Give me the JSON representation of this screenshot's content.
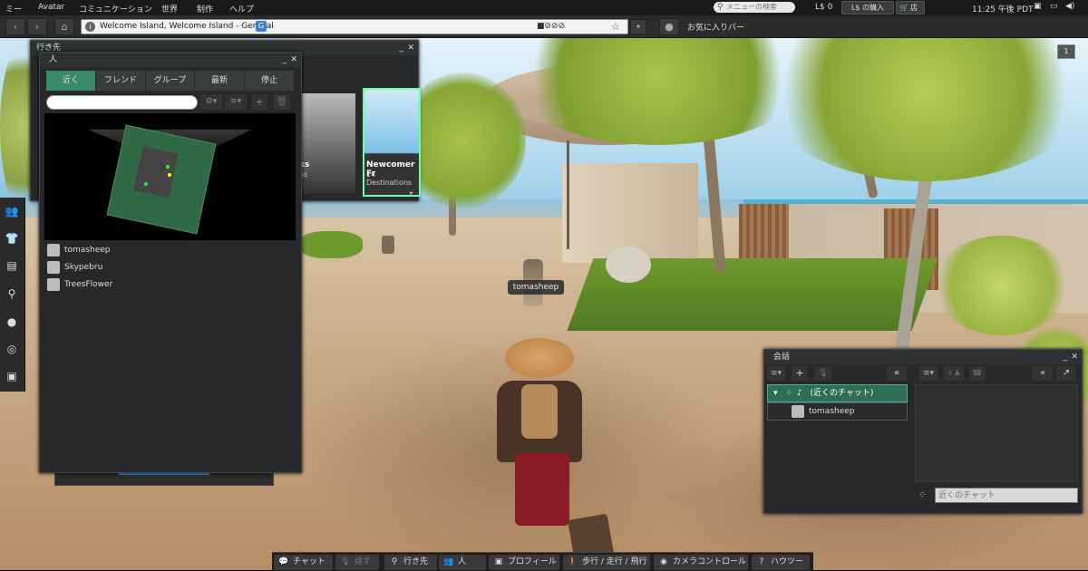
{
  "menu": {
    "items": [
      "ミー",
      "Avatar",
      "コミュニケーション",
      "世界",
      "制作",
      "ヘルプ"
    ],
    "search_placeholder": "メニューの検索",
    "balance": "L$ 0",
    "buy_label": "L$ の購入",
    "shop_label": "店",
    "time": "11:25 午後 PDT"
  },
  "nav": {
    "url": "Welcome Island, Welcome Island - General",
    "maturity_badge": "G",
    "favorites_label": "お気に入りバー"
  },
  "destinations_panel": {
    "title": "行き先",
    "card1_title": "ks",
    "card1_sub": "ns",
    "card2_title": "Newcomer Fr",
    "card2_sub": "14 Destinations"
  },
  "people_panel": {
    "title": "人",
    "tabs": [
      "近く",
      "フレンド",
      "グループ",
      "最新",
      "停止"
    ],
    "search_value": "",
    "people": [
      "tomasheep",
      "Skypebru",
      "TreesFlower"
    ]
  },
  "nametag": "tomasheep",
  "conversations": {
    "title": "会話",
    "group": "(近くのチャット)",
    "member": "tomasheep",
    "chat_placeholder": "近くのチャット"
  },
  "bottom": {
    "chat": "チャット",
    "speak": "話す",
    "destinations": "行き先",
    "people": "人",
    "profile": "プロフィール",
    "move": "歩行 / 走行 / 飛行",
    "camera": "カメラコントロール",
    "howto": "ハウツー"
  },
  "colors": {
    "accent_green": "#2e6f54",
    "panel_bg": "#262829",
    "tab_active": "#3a8a6a"
  }
}
